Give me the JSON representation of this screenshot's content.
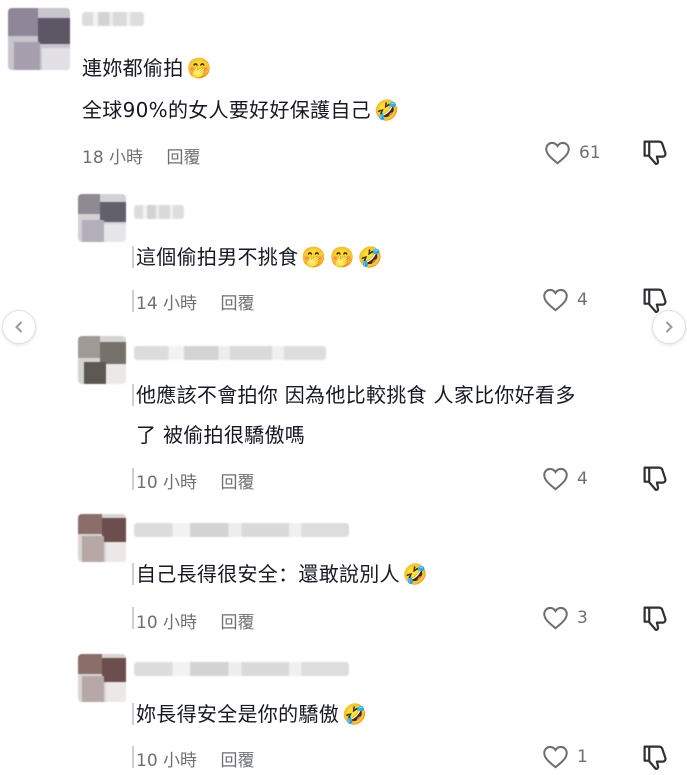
{
  "comments": [
    {
      "lines": [
        "連妳都偷拍",
        "全球90%的女人要好好保護自己"
      ],
      "emojis": [
        [
          "🤭"
        ],
        [
          "🤣"
        ]
      ],
      "time": "18 小時",
      "reply": "回覆",
      "likes": "61"
    },
    {
      "lines": [
        "這個偷拍男不挑食"
      ],
      "emojis": [
        [
          "🤭",
          "🤭",
          "🤣"
        ]
      ],
      "time": "14 小時",
      "reply": "回覆",
      "likes": "4"
    },
    {
      "lines": [
        "他應該不會拍你 因為他比較挑食 人家比你好看多",
        "了 被偷拍很驕傲嗎"
      ],
      "emojis": [
        [],
        []
      ],
      "time": "10 小時",
      "reply": "回覆",
      "likes": "4"
    },
    {
      "lines": [
        "自己長得很安全：還敢說別人"
      ],
      "emojis": [
        [
          "🤣"
        ]
      ],
      "time": "10 小時",
      "reply": "回覆",
      "likes": "3"
    },
    {
      "lines": [
        "妳長得安全是你的驕傲"
      ],
      "emojis": [
        [
          "🤣"
        ]
      ],
      "time": "10 小時",
      "reply": "回覆",
      "likes": "1"
    }
  ],
  "icons": {
    "like": "heart-outline-icon",
    "dislike": "thumbs-down-outline-icon",
    "prev": "chevron-left-icon",
    "next": "chevron-right-icon"
  },
  "colors": {
    "text": "#161823",
    "meta": "#6e6f74",
    "background": "#ffffff"
  }
}
